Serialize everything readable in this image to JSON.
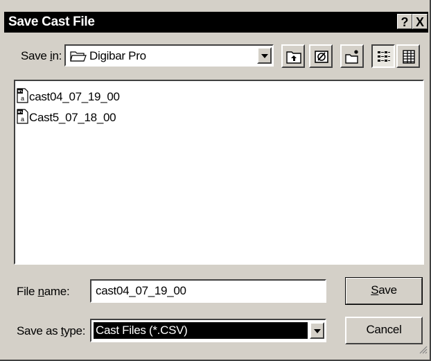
{
  "window": {
    "title": "Save Cast File",
    "help_label": "?",
    "close_label": "X"
  },
  "save_in": {
    "label_pre": "Save ",
    "label_key": "i",
    "label_post": "n:",
    "value": "Digibar Pro"
  },
  "toolbar": {
    "items": [
      {
        "name": "up-one-level-icon"
      },
      {
        "name": "view-desktop-icon"
      },
      {
        "name": "create-new-folder-icon"
      },
      {
        "name": "list-view-icon"
      },
      {
        "name": "details-view-icon"
      }
    ]
  },
  "files": [
    {
      "name": "cast04_07_19_00",
      "icon": "csv-file-icon"
    },
    {
      "name": "Cast5_07_18_00",
      "icon": "csv-file-icon"
    }
  ],
  "file_name": {
    "label_pre": "File ",
    "label_key": "n",
    "label_post": "ame:",
    "value": "cast04_07_19_00"
  },
  "save_type": {
    "label_pre": "Save as ",
    "label_key": "t",
    "label_post": "ype:",
    "value": "Cast Files (*.CSV)"
  },
  "buttons": {
    "save_key": "S",
    "save_rest": "ave",
    "cancel": "Cancel"
  }
}
